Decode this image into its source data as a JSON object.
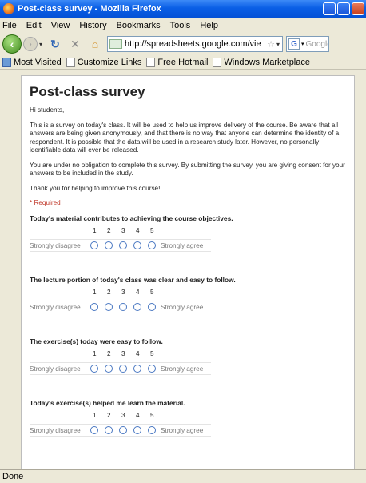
{
  "window": {
    "title": "Post-class survey - Mozilla Firefox"
  },
  "menu": [
    "File",
    "Edit",
    "View",
    "History",
    "Bookmarks",
    "Tools",
    "Help"
  ],
  "nav": {
    "url": "http://spreadsheets.google.com/vie",
    "search_placeholder": "Google",
    "search_engine": "G"
  },
  "bookmarks": [
    "Most Visited",
    "Customize Links",
    "Free Hotmail",
    "Windows Marketplace"
  ],
  "form": {
    "title": "Post-class survey",
    "greeting": "Hi students,",
    "intro": "This is a survey on today's class.  It will be used to help us improve delivery of the course.   Be aware that all answers are being given anonymously, and that there is no way that anyone can determine the identity of a respondent.  It is possible that the data will be used in a research study later.  However, no personally identifiable data will ever be released.",
    "obligation": "You are under no obligation to complete this survey.  By submitting the survey, you are giving consent for your answers to be included in the study.",
    "thanks": "Thank you for helping to improve this course!",
    "required": "* Required",
    "scale": [
      "1",
      "2",
      "3",
      "4",
      "5"
    ],
    "low_label": "Strongly disagree",
    "high_label": "Strongly agree",
    "questions": [
      "Today's material contributes to achieving the course objectives.",
      "The lecture portion of today's class was clear and easy to follow.",
      "The exercise(s) today were easy to follow.",
      "Today's exercise(s) helped me learn the material."
    ]
  },
  "status": "Done"
}
